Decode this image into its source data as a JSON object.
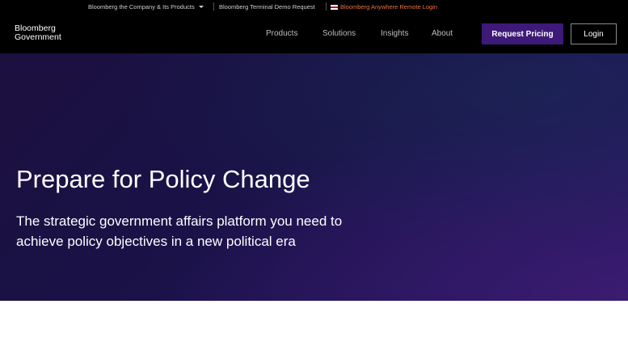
{
  "topbar": {
    "company_link": "Bloomberg the Company & Its Products",
    "demo_link": "Bloomberg Terminal Demo Request",
    "remote_login": "Bloomberg Anywhere Remote Login"
  },
  "header": {
    "logo_line1": "Bloomberg",
    "logo_line2": "Government",
    "nav": [
      "Products",
      "Solutions",
      "Insights",
      "About"
    ],
    "request_pricing": "Request Pricing",
    "login": "Login"
  },
  "hero": {
    "title": "Prepare for Policy Change",
    "subtitle": "The strategic government affairs platform you need to achieve policy objectives in a new political era"
  },
  "colors": {
    "brand_purple": "#3d1a78",
    "remote_login_orange": "#f0713b",
    "hero_dark": "#1b103e"
  }
}
